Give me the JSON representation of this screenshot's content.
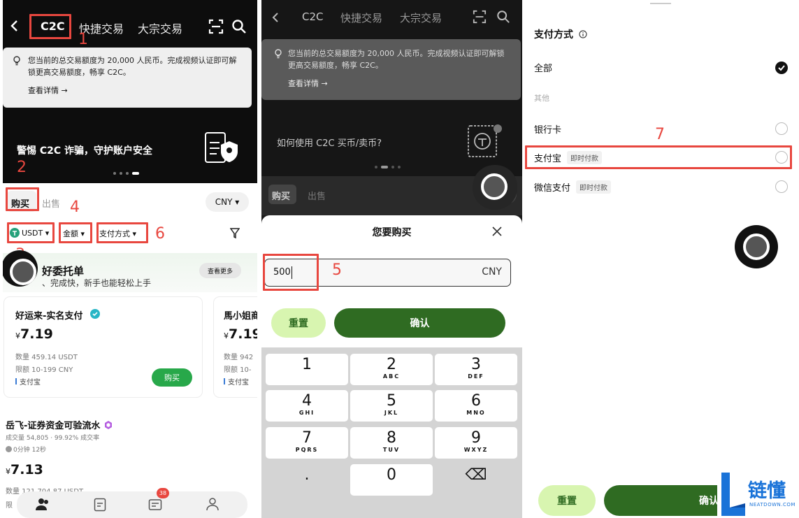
{
  "nav": {
    "c2c": "C2C",
    "quick": "快捷交易",
    "bulk": "大宗交易"
  },
  "notice": {
    "text": "您当前的总交易额度为 20,000 人民币。完成视频认证即可解锁更高交易额度，畅享 C2C。",
    "link": "查看详情 →"
  },
  "banner1": {
    "title": "警惕 C2C 诈骗，守护账户安全"
  },
  "banner2": {
    "title": "如何使用 C2C 买币/卖币?"
  },
  "tabs": {
    "buy": "购买",
    "sell": "出售",
    "currency": "CNY ▾"
  },
  "filters": {
    "coin": "USDT ▾",
    "amount": "金额 ▾",
    "payment": "支付方式 ▾"
  },
  "promo": {
    "title": "好委托单",
    "subtitle": "、完成快，新手也能轻松上手",
    "more": "查看更多"
  },
  "merchants": [
    {
      "name": "好运来-实名支付",
      "price": "7.19",
      "qty": "数量 459.14 USDT",
      "limit": "限额 10-199 CNY",
      "pay": "支付宝",
      "buy": "购买"
    },
    {
      "name": "馬小姐商",
      "price": "7.19",
      "qty": "数量 942",
      "limit": "限额 10-",
      "pay": "支付宝"
    }
  ],
  "listing": {
    "name": "岳飞-证券资金可验流水",
    "stats": "成交量 54,805 · 99.92% 成交率",
    "time": "0分钟 12秒",
    "price": "7.13",
    "qty": "数量 121,704.87 USDT",
    "limit": "限"
  },
  "currency_symbol": "¥",
  "badge_count": "38",
  "sheet": {
    "title": "您要购买",
    "input_value": "500",
    "unit": "CNY",
    "reset": "重置",
    "confirm": "确认"
  },
  "keypad": [
    {
      "n": "1",
      "l": ""
    },
    {
      "n": "2",
      "l": "ABC"
    },
    {
      "n": "3",
      "l": "DEF"
    },
    {
      "n": "4",
      "l": "GHI"
    },
    {
      "n": "5",
      "l": "JKL"
    },
    {
      "n": "6",
      "l": "MNO"
    },
    {
      "n": "7",
      "l": "PQRS"
    },
    {
      "n": "8",
      "l": "TUV"
    },
    {
      "n": "9",
      "l": "WXYZ"
    },
    {
      "n": ".",
      "l": ""
    },
    {
      "n": "0",
      "l": ""
    },
    {
      "n": "⌫",
      "l": ""
    }
  ],
  "payment": {
    "title": "支付方式",
    "all": "全部",
    "other": "其他",
    "bank": "银行卡",
    "alipay": "支付宝",
    "wechat": "微信支付",
    "instant": "即时付款",
    "reset": "重置",
    "confirm": "确认"
  },
  "steps": [
    "1",
    "2",
    "3",
    "4",
    "5",
    "6",
    "7"
  ],
  "logo": {
    "text": "链懂",
    "sub": "NEATDOWN.COM"
  },
  "colors": {
    "accent_red": "#e8473f",
    "dark_green": "#2f6b22",
    "light_green": "#d8f5b0",
    "buy_green": "#28a84a"
  }
}
